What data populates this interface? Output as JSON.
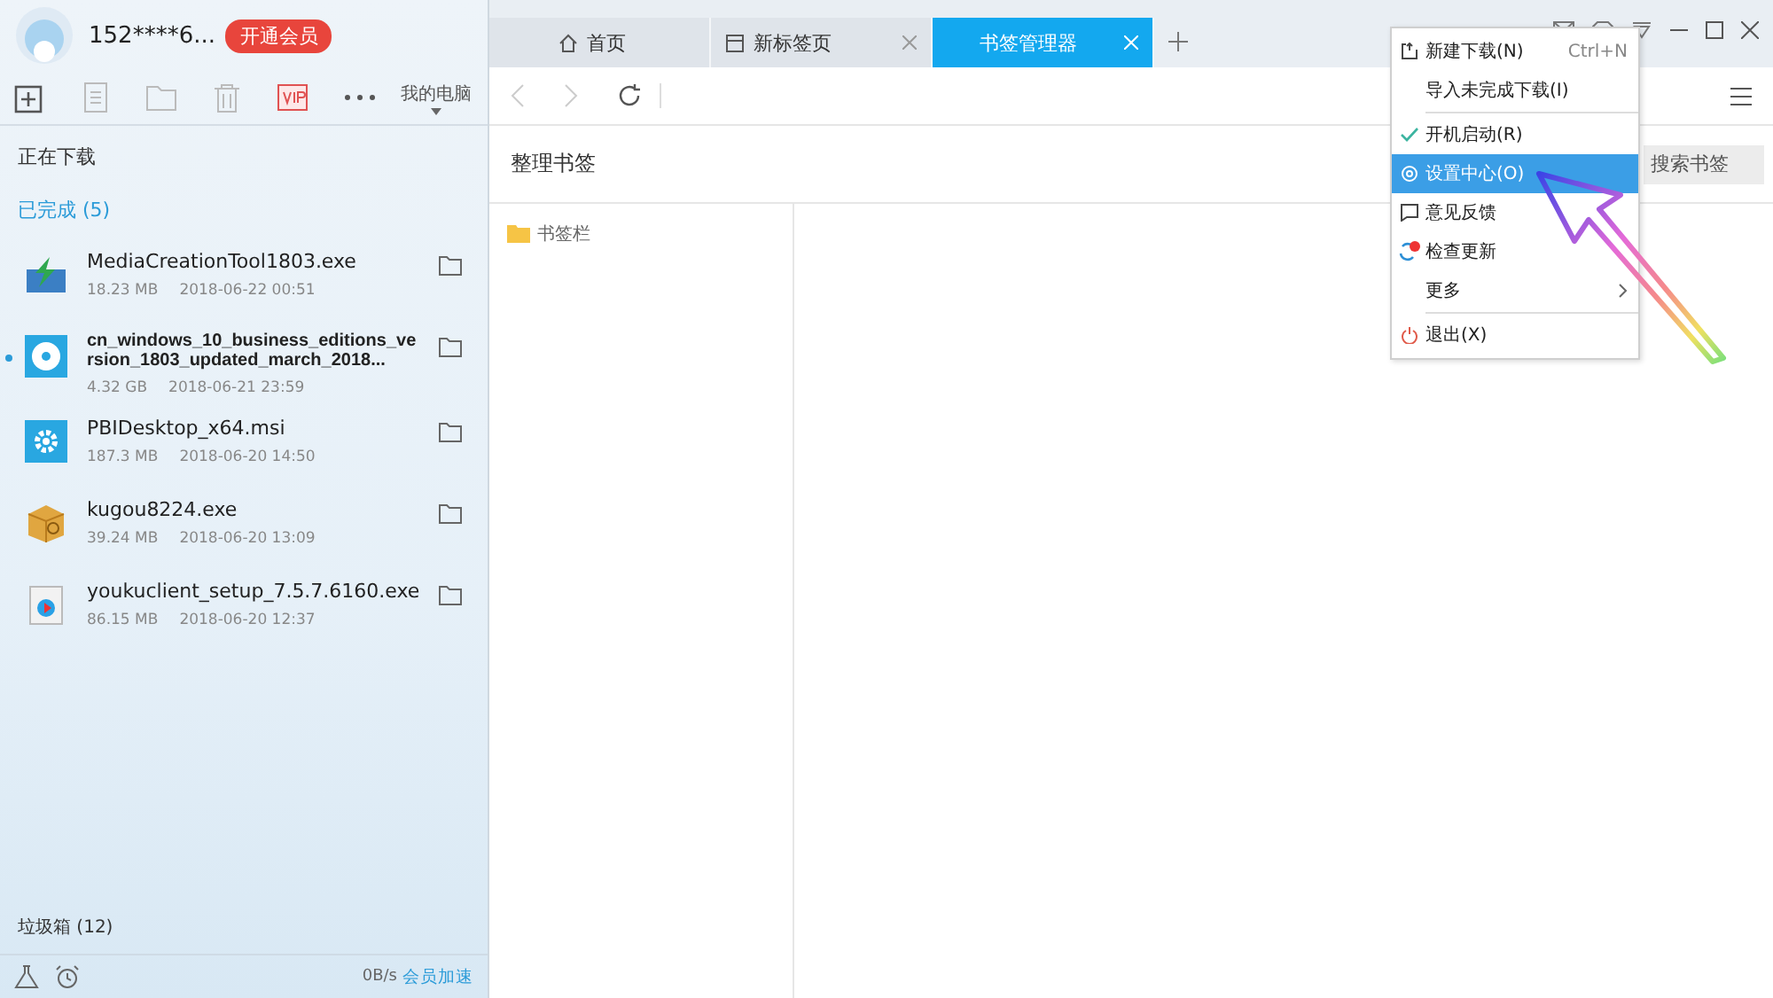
{
  "user": {
    "name": "152****6...",
    "vip_button": "开通会员"
  },
  "toolbar": {
    "device": "我的电脑"
  },
  "sections": {
    "downloading": "正在下载",
    "completed": "已完成 (5)"
  },
  "files": [
    {
      "name": "MediaCreationTool1803.exe",
      "size": "18.23 MB",
      "date": "2018-06-22 00:51",
      "kind": "installer",
      "marked": false
    },
    {
      "name": "cn_windows_10_business_editions_version_1803_updated_march_2018...",
      "size": "4.32 GB",
      "date": "2018-06-21 23:59",
      "kind": "disc",
      "marked": true
    },
    {
      "name": "PBIDesktop_x64.msi",
      "size": "187.3 MB",
      "date": "2018-06-20 14:50",
      "kind": "setup",
      "marked": false
    },
    {
      "name": "kugou8224.exe",
      "size": "39.24 MB",
      "date": "2018-06-20 13:09",
      "kind": "package",
      "marked": false
    },
    {
      "name": "youkuclient_setup_7.5.7.6160.exe",
      "size": "86.15 MB",
      "date": "2018-06-20 12:37",
      "kind": "player",
      "marked": false
    }
  ],
  "trash": "垃圾箱 (12)",
  "status": {
    "speed": "0B/s",
    "boost": "会员加速"
  },
  "tabs": [
    {
      "label": "首页",
      "closable": false,
      "selected": false
    },
    {
      "label": "新标签页",
      "closable": true,
      "selected": false
    },
    {
      "label": "书签管理器",
      "closable": true,
      "selected": true
    }
  ],
  "page": {
    "title": "整理书签",
    "search_placeholder": "搜索书签",
    "folders": [
      {
        "label": "书签栏"
      }
    ]
  },
  "menu": [
    {
      "kind": "item",
      "label": "新建下载(N)",
      "shortcut": "Ctrl+N",
      "checked": false,
      "selected": false
    },
    {
      "kind": "item",
      "label": "导入未完成下载(I)",
      "checked": false,
      "selected": false
    },
    {
      "kind": "separator"
    },
    {
      "kind": "item",
      "label": "开机启动(R)",
      "checked": true,
      "selected": false
    },
    {
      "kind": "item",
      "label": "设置中心(O)",
      "checked": false,
      "selected": true
    },
    {
      "kind": "item",
      "label": "意见反馈",
      "checked": false,
      "selected": false
    },
    {
      "kind": "item",
      "label": "检查更新",
      "checked": false,
      "selected": false
    },
    {
      "kind": "submenu",
      "label": "更多",
      "checked": false,
      "selected": false
    },
    {
      "kind": "separator"
    },
    {
      "kind": "item",
      "label": "退出(X)",
      "checked": false,
      "selected": false
    }
  ]
}
